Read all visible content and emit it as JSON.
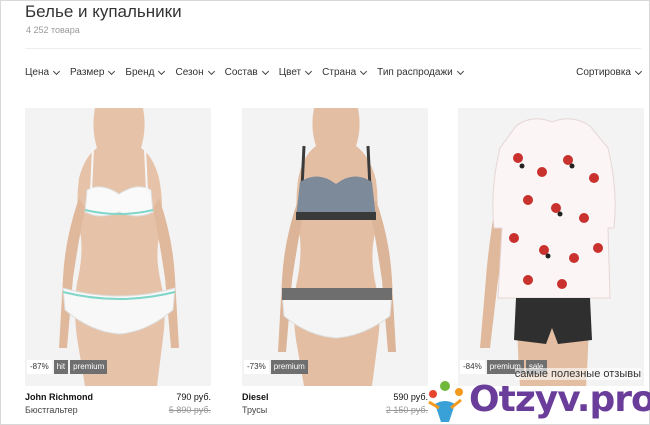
{
  "header": {
    "title": "Белье и купальники",
    "count": "4 252 товара"
  },
  "filters": [
    "Цена",
    "Размер",
    "Бренд",
    "Сезон",
    "Состав",
    "Цвет",
    "Страна",
    "Тип распродажи"
  ],
  "sort_label": "Сортировка",
  "products": [
    {
      "brand": "John Richmond",
      "category": "Бюстгальтер",
      "price": "790 руб.",
      "old_price": "5 890 руб.",
      "badges": [
        "-87%",
        "hit",
        "premium"
      ],
      "image": "model-white-lingerie"
    },
    {
      "brand": "Diesel",
      "category": "Трусы",
      "price": "590 руб.",
      "old_price": "2 150 руб.",
      "badges": [
        "-73%",
        "premium"
      ],
      "image": "model-grey-sport-bra"
    },
    {
      "brand": "",
      "category": "",
      "price": "",
      "old_price": "",
      "badges": [
        "-84%",
        "premium",
        "sale"
      ],
      "image": "model-pajama-set"
    }
  ],
  "watermark": {
    "tagline": "самые полезные отзывы",
    "site": "Otzyv.pro"
  },
  "colors": {
    "badge_dark": "#6f6f6f",
    "image_bg": "#f3f3f3",
    "watermark": "#6a3d9a"
  }
}
